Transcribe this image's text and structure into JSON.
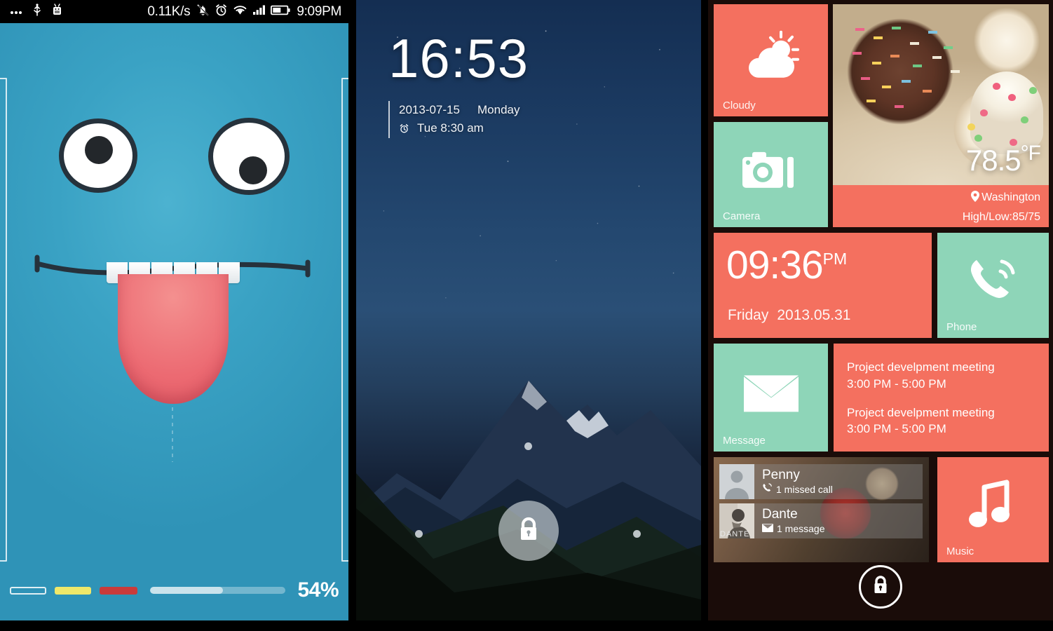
{
  "panel1": {
    "name": "monster-lockscreen",
    "statusbar": {
      "dots_icon": "more-dots-icon",
      "usb_icon": "usb-icon",
      "android_icon": "android-robot-icon",
      "net_speed": "0.11K/s",
      "mute_icon": "silent-bell-icon",
      "alarm_icon": "alarm-clock-icon",
      "wifi_icon": "wifi-icon",
      "signal_icon": "cell-signal-icon",
      "battery_icon": "battery-icon",
      "time": "9:09PM"
    },
    "battery_percent_label": "54%",
    "battery_percent_value": 54,
    "bars": [
      {
        "name": "outline-chip",
        "color": "#ffffff"
      },
      {
        "name": "yellow-chip",
        "color": "#efe86a"
      },
      {
        "name": "red-chip",
        "color": "#ca3b3b"
      }
    ],
    "background_color": "#3aa2c4",
    "face": {
      "eye_icon": "eye-icon",
      "tongue_icon": "tongue-icon",
      "teeth_count": 6
    }
  },
  "panel2": {
    "name": "mountain-lockscreen",
    "time": "16:53",
    "date": "2013-07-15",
    "weekday": "Monday",
    "alarm_icon": "alarm-clock-icon",
    "alarm_text": "Tue 8:30 am",
    "lock_icon": "lock-icon",
    "dots": [
      "dot-top",
      "dot-left",
      "dot-right"
    ]
  },
  "panel3": {
    "name": "metro-tiles-lockscreen",
    "accent_salmon": "#f4705f",
    "accent_mint": "#8ed5b8",
    "background_color": "#1a0c09",
    "tiles": {
      "cloudy": {
        "label": "Cloudy",
        "icon": "sun-cloud-icon"
      },
      "camera": {
        "label": "Camera",
        "icon": "camera-icon"
      },
      "phone": {
        "label": "Phone",
        "icon": "phone-ringing-icon"
      },
      "message": {
        "label": "Message",
        "icon": "envelope-icon"
      },
      "music": {
        "label": "Music",
        "icon": "music-note-icon"
      }
    },
    "weather": {
      "temperature": "78.5",
      "degree_unit": "°F",
      "location_icon": "location-pin-icon",
      "location": "Washington",
      "high_low": "High/Low:85/75"
    },
    "clock": {
      "time": "09:36",
      "ampm": "PM",
      "weekday": "Friday",
      "date": "2013.05.31"
    },
    "calendar": {
      "events": [
        {
          "title": "Project develpment meeting",
          "time": "3:00 PM - 5:00 PM"
        },
        {
          "title": "Project develpment meeting",
          "time": "3:00 PM - 5:00 PM"
        }
      ]
    },
    "contacts": [
      {
        "name": "Penny",
        "meta": "1 missed call",
        "icon": "missed-call-icon",
        "avatar": "generic-person-avatar",
        "tag": ""
      },
      {
        "name": "Dante",
        "meta": "1 message",
        "icon": "envelope-icon",
        "avatar": "photo-avatar",
        "tag": "DANTE"
      }
    ],
    "lock_icon": "lock-icon"
  }
}
